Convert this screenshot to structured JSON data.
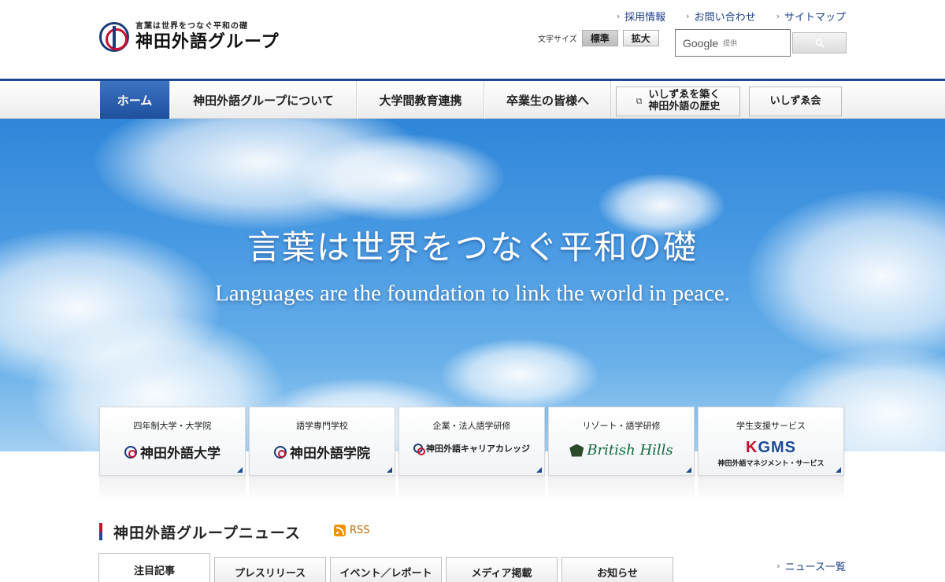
{
  "header": {
    "logo_tagline": "言葉は世界をつなぐ平和の礎",
    "logo_name": "神田外語グループ",
    "util_links": [
      "採用情報",
      "お問い合わせ",
      "サイトマップ"
    ],
    "font_size_label": "文字サイズ",
    "font_size_options": [
      "標準",
      "拡大"
    ],
    "font_size_selected": "標準",
    "search_brand": "Google",
    "search_provided": "提供"
  },
  "nav": {
    "items": [
      "ホーム",
      "神田外語グループについて",
      "大学間教育連携",
      "卒業生の皆様へ"
    ],
    "active": "ホーム",
    "history_line1": "いしずゑを築く",
    "history_line2": "神田外語の歴史",
    "ishizue": "いしずゑ会"
  },
  "hero": {
    "title_jp": "言葉は世界をつなぐ平和の礎",
    "title_en": "Languages are the foundation to link the world in peace."
  },
  "cards": [
    {
      "category": "四年制大学・大学院",
      "name": "神田外語大学"
    },
    {
      "category": "語学専門学校",
      "name": "神田外語学院"
    },
    {
      "category": "企業・法人語学研修",
      "name": "神田外語キャリアカレッジ"
    },
    {
      "category": "リゾート・語学研修",
      "name": "British Hills"
    },
    {
      "category": "学生支援サービス",
      "name": "KGMS",
      "sub": "神田外語マネジメント・サービス"
    }
  ],
  "news": {
    "title": "神田外語グループニュース",
    "rss": "RSS",
    "tabs": [
      "注目記事",
      "プレスリリース",
      "イベント／レポート",
      "メディア掲載",
      "お知らせ"
    ],
    "active_tab": "注目記事",
    "all_link": "ニュース一覧"
  },
  "colors": {
    "nav_accent": "#1c4a95",
    "brand_red": "#c8102e",
    "kgms_red": "#c8102e",
    "kgms_blue": "#1c4a95",
    "british_hills_green": "#0e6b3a",
    "rss_orange": "#f29200"
  },
  "icons": {
    "search": "search-icon",
    "rss": "rss-icon",
    "external": "external-window-icon",
    "chevron": "chevron-right-icon"
  }
}
